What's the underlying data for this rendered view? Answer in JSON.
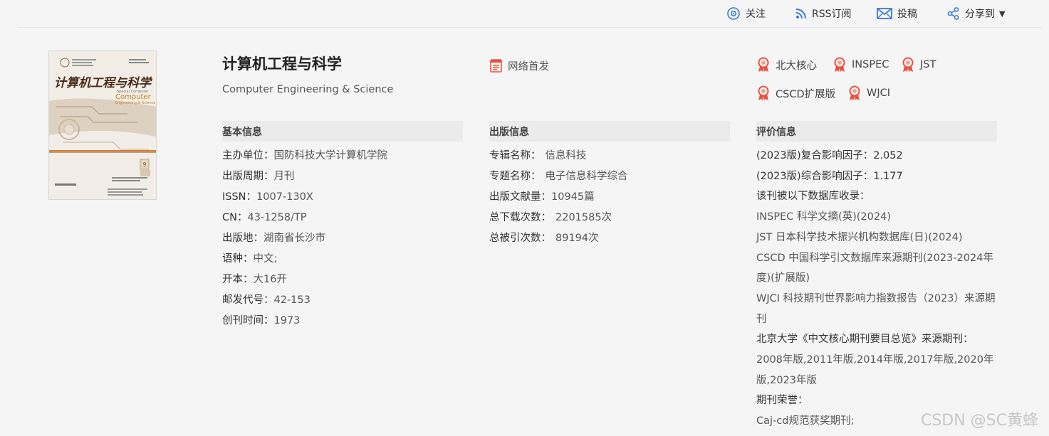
{
  "toolbar": {
    "follow_label": "关注",
    "rss_label": "RSS订阅",
    "submit_label": "投稿",
    "share_label": "分享到",
    "accent_color": "#3a7bd5"
  },
  "cover": {
    "title_text": "计算机工程与科学",
    "en_title": "Computer Engineering & Science",
    "issue": "9"
  },
  "journal": {
    "title_cn": "计算机工程与科学",
    "title_en": "Computer Engineering & Science",
    "net_first": "网络首发"
  },
  "badges": [
    "北大核心",
    "INSPEC",
    "JST",
    "CSCD扩展版",
    "WJCI"
  ],
  "basic": {
    "heading": "基本信息",
    "rows": [
      {
        "key": "主办单位：",
        "value": "国防科技大学计算机学院"
      },
      {
        "key": "出版周期：",
        "value": "月刊"
      },
      {
        "key": "ISSN：",
        "value": "1007-130X"
      },
      {
        "key": "CN：",
        "value": "43-1258/TP"
      },
      {
        "key": "出版地：",
        "value": "湖南省长沙市"
      },
      {
        "key": "语种：",
        "value": "中文;"
      },
      {
        "key": "开本：",
        "value": "大16开"
      },
      {
        "key": "邮发代号：",
        "value": "42-153"
      },
      {
        "key": "创刊时间：",
        "value": "1973"
      }
    ]
  },
  "publish": {
    "heading": "出版信息",
    "rows": [
      {
        "key": "专辑名称：",
        "value": "信息科技"
      },
      {
        "key": "专题名称：",
        "value": "电子信息科学综合"
      },
      {
        "key": "出版文献量：",
        "value": "10945篇"
      },
      {
        "key": "总下载次数：",
        "value": "2201585次"
      },
      {
        "key": "总被引次数：",
        "value": "89194次"
      }
    ]
  },
  "evaluation": {
    "heading": "评价信息",
    "lines": [
      {
        "text": "(2023版)复合影响因子：2.052",
        "style": "dark"
      },
      {
        "text": "(2023版)综合影响因子：1.177",
        "style": "dark"
      },
      {
        "text": "该刊被以下数据库收录：",
        "style": "dark"
      },
      {
        "text": "INSPEC 科学文摘(英)(2024)",
        "style": "muted"
      },
      {
        "text": "JST 日本科学技术振兴机构数据库(日)(2024)",
        "style": "muted"
      },
      {
        "text": "CSCD 中国科学引文数据库来源期刊(2023-2024年度)(扩展版)",
        "style": "muted"
      },
      {
        "text": "WJCI 科技期刊世界影响力指数报告（2023）来源期刊",
        "style": "muted"
      },
      {
        "text": "北京大学《中文核心期刊要目总览》来源期刊：",
        "style": "dark"
      },
      {
        "text": "2008年版,2011年版,2014年版,2017年版,2020年版,2023年版",
        "style": "muted"
      },
      {
        "text": "期刊荣誉：",
        "style": "dark"
      },
      {
        "text": "Caj-cd规范获奖期刊;",
        "style": "muted"
      }
    ]
  },
  "watermark": "CSDN @SC黄蜂"
}
